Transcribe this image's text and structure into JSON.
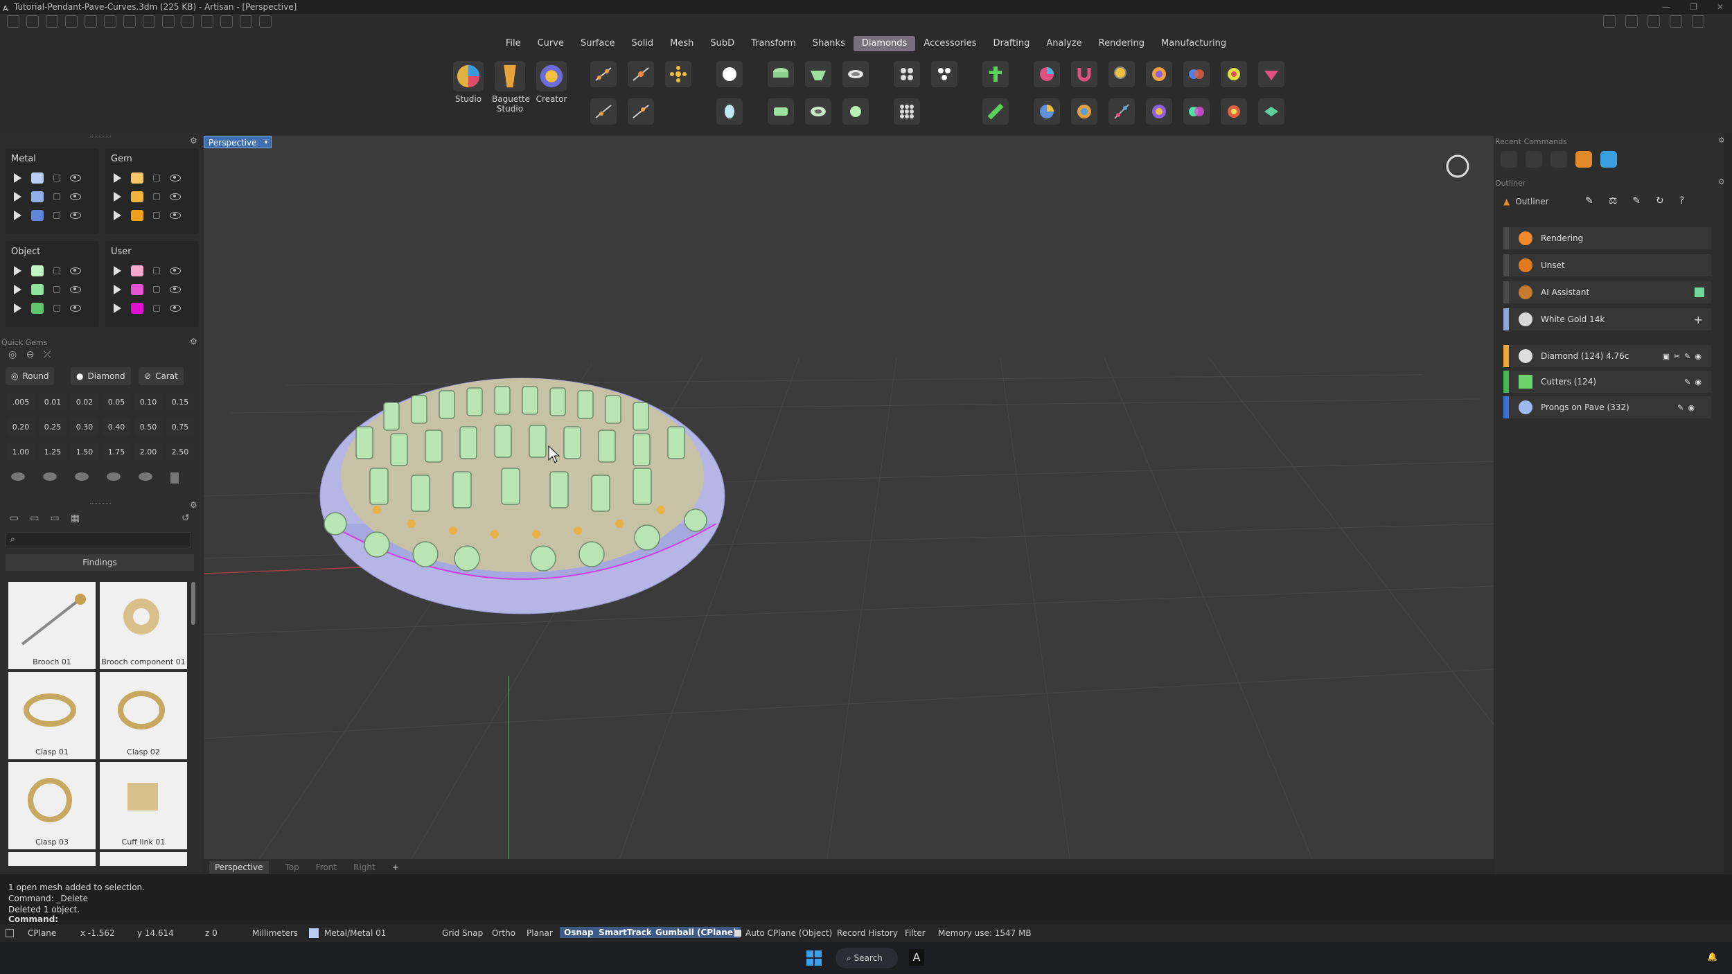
{
  "window": {
    "title": "Tutorial-Pendant-Pave-Curves.3dm (225 KB) - Artisan - [Perspective]",
    "controls": [
      "—",
      "❐",
      "✕"
    ]
  },
  "menu": [
    "File",
    "Curve",
    "Surface",
    "Solid",
    "Mesh",
    "SubD",
    "Transform",
    "Shanks",
    "Diamonds",
    "Accessories",
    "Drafting",
    "Analyze",
    "Rendering",
    "Manufacturing"
  ],
  "menu_active": "Diamonds",
  "ribbon": {
    "studio": "Studio",
    "baguette_1": "Baguette",
    "baguette_2": "Studio",
    "creator": "Creator"
  },
  "layers": {
    "metal": {
      "title": "Metal",
      "colors": [
        "#b9cdf5",
        "#8fb0ea",
        "#5f86d8"
      ]
    },
    "gem": {
      "title": "Gem",
      "colors": [
        "#f6c766",
        "#f2b33a",
        "#eea21a"
      ]
    },
    "object": {
      "title": "Object",
      "colors": [
        "#bff4c4",
        "#8fe39a",
        "#61c46e"
      ]
    },
    "user": {
      "title": "User",
      "colors": [
        "#f5a8cc",
        "#e654d4",
        "#e010d0"
      ]
    }
  },
  "quick_gems": {
    "title": "Quick Gems",
    "cut": "Round",
    "type": "Diamond",
    "unit": "Carat",
    "values": [
      "0.005",
      "0.01",
      "0.02",
      "0.05",
      "0.10",
      "0.15",
      "0.20",
      "0.25",
      "0.30",
      "0.40",
      "0.50",
      "0.75",
      "1.00",
      "1.25",
      "1.50",
      "1.75",
      "2.00",
      "2.50"
    ],
    "display_values": [
      ".005",
      "0.01",
      "0.02",
      "0.05",
      "0.10",
      "0.15",
      "0.20",
      "0.25",
      "0.30",
      "0.40",
      "0.50",
      "0.75",
      "1.00",
      "1.25",
      "1.50",
      "1.75",
      "2.00",
      "2.50"
    ]
  },
  "library": {
    "category": "Findings",
    "search_placeholder": "",
    "items": [
      "Brooch 01",
      "Brooch component 01",
      "Clasp 01",
      "Clasp 02",
      "Clasp 03",
      "Cuff link 01"
    ]
  },
  "viewport": {
    "name": "Perspective",
    "tabs": [
      "Perspective",
      "Top",
      "Front",
      "Right",
      "+"
    ]
  },
  "right": {
    "recent_title": "Recent Commands",
    "outliner_title": "Outliner",
    "outliner_label": "Outliner",
    "rows": [
      {
        "label": "Rendering",
        "bar": "#4a4a4a",
        "icon": "#f08a2a"
      },
      {
        "label": "Unset",
        "bar": "#4a4a4a",
        "icon": "#e07a20"
      },
      {
        "label": "AI Assistant",
        "bar": "#4a4a4a",
        "icon": "#c77b30"
      },
      {
        "label": "White Gold 14k",
        "bar": "#8fa6dd",
        "icon": "#d8d8d8"
      },
      {
        "label": "Diamond (124) 4.76c",
        "bar": "#f0a637",
        "icon": "#dddddd"
      },
      {
        "label": "Cutters (124)",
        "bar": "#43b856",
        "icon": "#6dd46d"
      },
      {
        "label": "Prongs on Pave (332)",
        "bar": "#3a6fd6",
        "icon": "#9fbaf0"
      }
    ]
  },
  "command": {
    "history": [
      "1 open mesh added to selection.",
      "Command: _Delete",
      "Deleted 1 object."
    ],
    "prompt": "Command:"
  },
  "status": {
    "cplane": "CPlane",
    "x": "x -1.562",
    "y": "y 14.614",
    "z": "z 0",
    "units": "Millimeters",
    "layer": "Metal/Metal 01",
    "grid_snap": "Grid Snap",
    "ortho": "Ortho",
    "planar": "Planar",
    "osnap": "Osnap",
    "smarttrack": "SmartTrack",
    "gumball": "Gumball (CPlane)",
    "auto_cplane": "Auto CPlane (Object)",
    "record_history": "Record History",
    "filter": "Filter",
    "memory": "Memory use: 1547 MB"
  },
  "taskbar": {
    "search": "Search"
  }
}
